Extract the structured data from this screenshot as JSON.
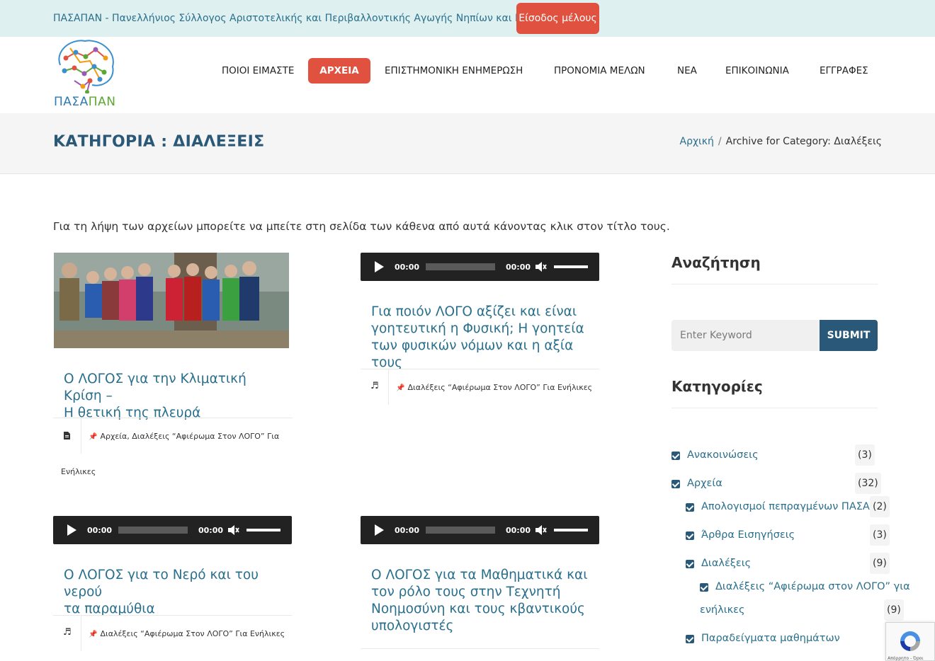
{
  "topbar": {
    "org_name": "ΠΑΣΑΠΑΝ - Πανελλήνιος Σύλλογος Αριστοτελικής και Περιβαλλοντικής Αγωγής Νηπίων και Νέων",
    "login_label": "Είσοδος μέλους"
  },
  "logo": {
    "text_part1": "ΠΑΣΑ",
    "text_part2": "ΠΑΝ"
  },
  "nav": {
    "items": [
      {
        "label": "ΠΟΙΟΙ ΕΙΜΑΣΤΕ"
      },
      {
        "label": "ΑΡΧΕΙΑ"
      },
      {
        "label": "ΕΠΙΣΤΗΜΟΝΙΚΗ ΕΝΗΜΕΡΩΣΗ"
      },
      {
        "label": "ΠΡΟΝΟΜΙΑ ΜΕΛΩΝ"
      },
      {
        "label": "ΝΕΑ"
      },
      {
        "label": "ΕΠΙΚΟΙΝΩΝΙΑ"
      },
      {
        "label": "ΕΓΓΡΑΦΕΣ"
      }
    ],
    "active_index": 1
  },
  "page": {
    "title": "ΚΑΤΗΓΟΡΙΑ : ΔΙΑΛΕΞΕΙΣ",
    "breadcrumb_home": "Αρχική",
    "breadcrumb_sep": "/",
    "breadcrumb_current": "Archive for Category: Διαλέξεις",
    "intro": "Για τη λήψη των αρχείων μπορείτε να μπείτε στη σελίδα των κάθενα από αυτά κάνοντας κλικ στον τίτλο τους."
  },
  "posts": [
    {
      "title_lines": [
        "Ο ΛΟΓΟΣ για την Κλιματική Κρίση –",
        "Η θετική της πλευρά"
      ],
      "meta_line1": "Αρχεία, Διαλέξεις “Αφιέρωμα Στον ΛΟΓΟ” Για",
      "meta_line2": "Ενήλικες",
      "format_icon": "document-icon"
    },
    {
      "title_lines": [
        "Για ποιόν ΛΟΓΟ αξίζει και είναι",
        "γοητευτική η Φυσική; Η γοητεία",
        "των φυσικών νόμων και η αξία τους"
      ],
      "meta_line1": "Διαλέξεις “Αφιέρωμα Στον ΛΟΓΟ” Για Ενήλικες",
      "player_time": "00:00",
      "player_duration": "00:00",
      "format_icon": "music-icon"
    },
    {
      "title_lines": [
        "Ο ΛΟΓΟΣ για το Νερό και του νερού",
        "τα παραμύθια"
      ],
      "meta_line1": "Διαλέξεις “Αφιέρωμα Στον ΛΟΓΟ” Για Ενήλικες",
      "player_time": "00:00",
      "player_duration": "00:00",
      "format_icon": "music-icon"
    },
    {
      "title_lines": [
        "Ο ΛΟΓΟΣ για τα Μαθηματικά και",
        "τον ρόλο τους στην Τεχνητή",
        "Νοημοσύνη και τους κβαντικούς",
        "υπολογιστές"
      ],
      "player_time": "00:00",
      "player_duration": "00:00"
    }
  ],
  "sidebar": {
    "search_heading": "Αναζήτηση",
    "search_placeholder": "Enter Keyword",
    "submit_label": "SUBMIT",
    "categories_heading": "Κατηγορίες",
    "categories": [
      {
        "label": "Ανακοινώσεις",
        "count": "(3)"
      },
      {
        "label": "Αρχεία",
        "count": "(32)"
      },
      {
        "label": "Απολογισμοί πεπραγμένων ΠΑΣΑΠΑ",
        "count": "(2)"
      },
      {
        "label": "Άρθρα Εισηγήσεις",
        "count": "(3)"
      },
      {
        "label": "Διαλέξεις",
        "count": "(9)"
      },
      {
        "label": "Διαλέξεις “Αφιέρωμα στον ΛΟΓΟ” για",
        "label_line2": "ενήλικες",
        "count": "(9)"
      },
      {
        "label": "Παραδείγματα μαθημάτων"
      }
    ]
  },
  "recaptcha": {
    "footer_text": "Απόρρητο - Όροι"
  },
  "colors": {
    "accent": "#e0523f",
    "primary": "#2a5878",
    "link": "#2a6f8c",
    "topbar_bg": "#dff0f1"
  }
}
